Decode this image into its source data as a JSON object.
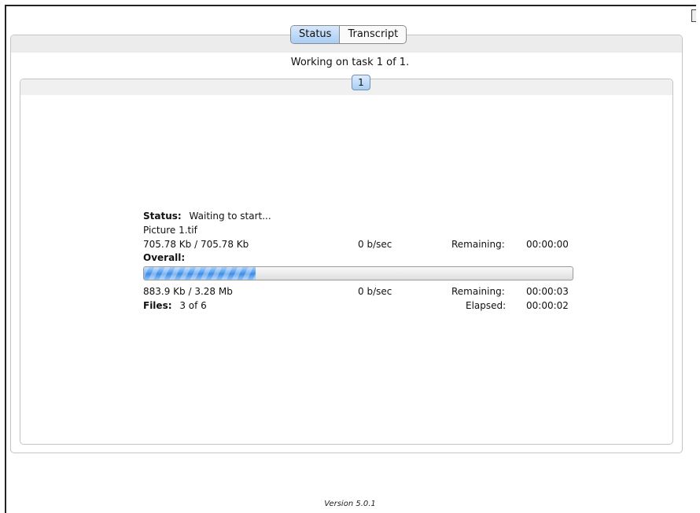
{
  "tabs": [
    {
      "label": "Status",
      "selected": true
    },
    {
      "label": "Transcript",
      "selected": false
    }
  ],
  "working_text": "Working on task 1 of 1.",
  "task_tab_label": "1",
  "status": {
    "label": "Status:",
    "value": "Waiting to start..."
  },
  "current_file": {
    "name": "Picture 1.tif",
    "size": "705.78 Kb / 705.78 Kb",
    "rate": "0 b/sec",
    "remaining_label": "Remaining:",
    "remaining_value": "00:00:00"
  },
  "overall": {
    "label": "Overall:",
    "progress_fraction": 0.26,
    "size": "883.9 Kb / 3.28 Mb",
    "rate": "0 b/sec",
    "remaining_label": "Remaining:",
    "remaining_value": "00:00:03"
  },
  "files": {
    "label": "Files:",
    "value": "3 of 6",
    "elapsed_label": "Elapsed:",
    "elapsed_value": "00:00:02"
  },
  "version": "Version 5.0.1",
  "colors": {
    "progress": "#3f8ee6",
    "tab_selected": "#a9cdf4"
  }
}
